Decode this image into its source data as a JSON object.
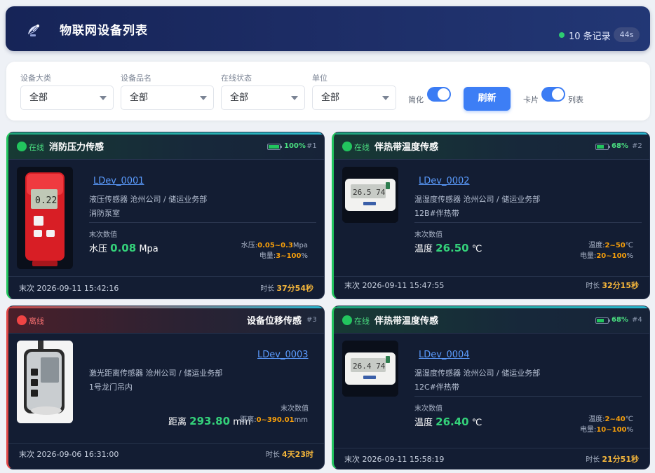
{
  "header": {
    "title": "物联网设备列表",
    "record_count": "10 条记录",
    "refresh_timer": "44s"
  },
  "filters": {
    "category": {
      "label": "设备大类",
      "value": "全部"
    },
    "product": {
      "label": "设备品名",
      "value": "全部"
    },
    "online_status": {
      "label": "在线状态",
      "value": "全部"
    },
    "unit": {
      "label": "单位",
      "value": "全部"
    },
    "simplify_label": "简化",
    "simplify_on": true,
    "refresh_label": "刷新",
    "view_card_label": "卡片",
    "view_list_label": "列表",
    "view_list_on": true
  },
  "labels": {
    "last_value": "末次数值",
    "last": "末次",
    "duration": "时长"
  },
  "cards": [
    {
      "status": "在线",
      "name": "消防压力传感",
      "battery": "100%",
      "battery_level": 1.0,
      "index": "#1",
      "device_id": "LDev_0001",
      "type_org": "液压传感器  沧州公司 / 储运业务部",
      "location": "消防泵室",
      "reading_label": "水压",
      "reading_value": "0.08",
      "reading_unit": "Mpa",
      "range1_label": "水压:",
      "range1_value": "0.05~0.3",
      "range1_unit": "Mpa",
      "range2_label": "电量:",
      "range2_value": "3~100",
      "range2_unit": "%",
      "last_time": "2026-09-11 15:42:16",
      "duration": "37分54秒"
    },
    {
      "status": "在线",
      "name": "伴热带温度传感",
      "battery": "68%",
      "battery_level": 0.68,
      "index": "#2",
      "device_id": "LDev_0002",
      "type_org": "温湿度传感器  沧州公司 / 储运业务部",
      "location": "12B#伴热带",
      "reading_label": "温度",
      "reading_value": "26.50",
      "reading_unit": "℃",
      "range1_label": "温度:",
      "range1_value": "2~50",
      "range1_unit": "℃",
      "range2_label": "电量:",
      "range2_value": "20~100",
      "range2_unit": "%",
      "last_time": "2026-09-11 15:47:55",
      "duration": "32分15秒"
    },
    {
      "status": "离线",
      "name": "设备位移传感",
      "index": "#3",
      "device_id": "LDev_0003",
      "type_org": "激光距离传感器  沧州公司 / 储运业务部",
      "location": "1号龙门吊内",
      "reading_label": "距离",
      "reading_value": "293.80",
      "reading_unit": "mm",
      "range1_label": "距离:",
      "range1_value": "0~390.01",
      "range1_unit": "mm",
      "last_time": "2026-09-06 16:31:00",
      "duration": "4天23时"
    },
    {
      "status": "在线",
      "name": "伴热带温度传感",
      "battery": "68%",
      "battery_level": 0.68,
      "index": "#4",
      "device_id": "LDev_0004",
      "type_org": "温湿度传感器  沧州公司 / 储运业务部",
      "location": "12C#伴热带",
      "reading_label": "温度",
      "reading_value": "26.40",
      "reading_unit": "℃",
      "range1_label": "温度:",
      "range1_value": "2~40",
      "range1_unit": "℃",
      "range2_label": "电量:",
      "range2_value": "10~100",
      "range2_unit": "%",
      "last_time": "2026-09-11 15:58:19",
      "duration": "21分51秒"
    }
  ]
}
